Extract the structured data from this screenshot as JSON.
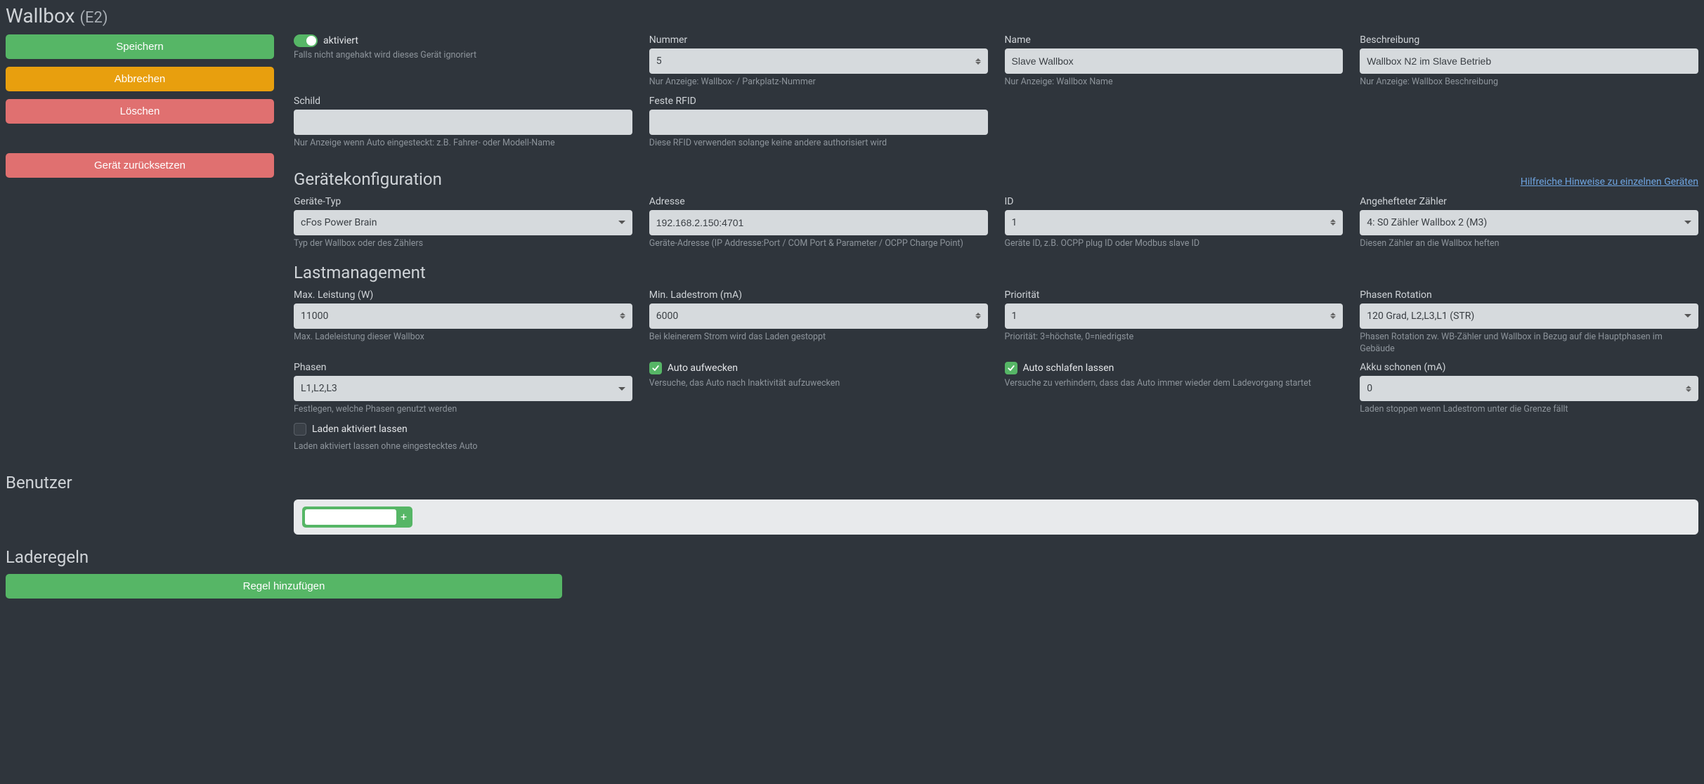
{
  "title": {
    "main": "Wallbox",
    "sub": "(E2)"
  },
  "sidebar": {
    "save": "Speichern",
    "cancel": "Abbrechen",
    "delete": "Löschen",
    "reset": "Gerät zurücksetzen"
  },
  "activated": {
    "label": "aktiviert",
    "help": "Falls nicht angehakt wird dieses Gerät ignoriert"
  },
  "number": {
    "label": "Nummer",
    "value": "5",
    "help": "Nur Anzeige: Wallbox- / Parkplatz-Nummer"
  },
  "name": {
    "label": "Name",
    "value": "Slave Wallbox",
    "help": "Nur Anzeige: Wallbox Name"
  },
  "desc": {
    "label": "Beschreibung",
    "value": "Wallbox N2 im Slave Betrieb",
    "help": "Nur Anzeige: Wallbox Beschreibung"
  },
  "schild": {
    "label": "Schild",
    "value": "",
    "help": "Nur Anzeige wenn Auto eingesteckt: z.B. Fahrer- oder Modell-Name"
  },
  "rfid": {
    "label": "Feste RFID",
    "value": "",
    "help": "Diese RFID verwenden solange keine andere authorisiert wird"
  },
  "config_section": "Gerätekonfiguration",
  "hints_link": "Hilfreiche Hinweise zu einzelnen Geräten",
  "devtype": {
    "label": "Geräte-Typ",
    "value": "cFos Power Brain",
    "help": "Typ der Wallbox oder des Zählers"
  },
  "address": {
    "label": "Adresse",
    "value": "192.168.2.150:4701",
    "help": "Geräte-Adresse (IP Addresse:Port / COM Port & Parameter / OCPP Charge Point)"
  },
  "id": {
    "label": "ID",
    "value": "1",
    "help": "Geräte ID, z.B. OCPP plug ID oder Modbus slave ID"
  },
  "attached": {
    "label": "Angehefteter Zähler",
    "value": "4: S0 Zähler Wallbox 2 (M3)",
    "help": "Diesen Zähler an die Wallbox heften"
  },
  "load_section": "Lastmanagement",
  "maxpower": {
    "label": "Max. Leistung (W)",
    "value": "11000",
    "help": "Max. Ladeleistung dieser Wallbox"
  },
  "mincurr": {
    "label": "Min. Ladestrom (mA)",
    "value": "6000",
    "help": "Bei kleinerem Strom wird das Laden gestoppt"
  },
  "priority": {
    "label": "Priorität",
    "value": "1",
    "help": "Priorität: 3=höchste, 0=niedrigste"
  },
  "phaserot": {
    "label": "Phasen Rotation",
    "value": "120 Grad, L2,L3,L1 (STR)",
    "help": "Phasen Rotation zw. WB-Zähler und Wallbox in Bezug auf die Hauptphasen im Gebäude"
  },
  "phases": {
    "label": "Phasen",
    "value": "L1,L2,L3",
    "help": "Festlegen, welche Phasen genutzt werden"
  },
  "wake": {
    "label": "Auto aufwecken",
    "help": "Versuche, das Auto nach Inaktivität aufzuwecken"
  },
  "sleep": {
    "label": "Auto schlafen lassen",
    "help": "Versuche zu verhindern, dass das Auto immer wieder dem Ladevorgang startet"
  },
  "akku": {
    "label": "Akku schonen (mA)",
    "value": "0",
    "help": "Laden stoppen wenn Ladestrom unter die Grenze fällt"
  },
  "keep": {
    "label": "Laden aktiviert lassen",
    "help": "Laden aktiviert lassen ohne eingestecktes Auto"
  },
  "users_section": "Benutzer",
  "rules_section": "Laderegeln",
  "add_rule": "Regel hinzufügen"
}
